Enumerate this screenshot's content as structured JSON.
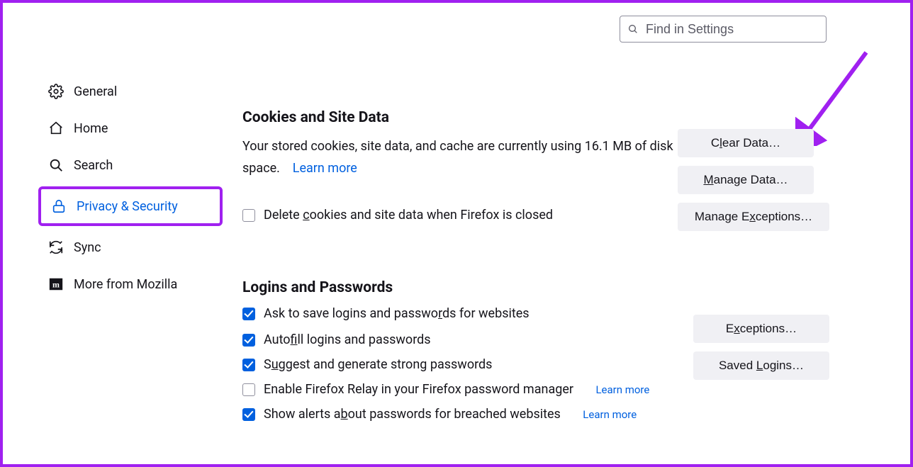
{
  "search": {
    "placeholder": "Find in Settings"
  },
  "sidebar": {
    "items": [
      {
        "label": "General"
      },
      {
        "label": "Home"
      },
      {
        "label": "Search"
      },
      {
        "label": "Privacy & Security"
      },
      {
        "label": "Sync"
      },
      {
        "label": "More from Mozilla"
      }
    ]
  },
  "cookies": {
    "heading": "Cookies and Site Data",
    "desc_prefix": "Your stored cookies, site data, and cache are currently using ",
    "size": "16.1 MB",
    "desc_suffix": " of disk space.",
    "learn_more": "Learn more",
    "delete_on_close": "Delete cookies and site data when Firefox is closed",
    "btn_clear": "Clear Data…",
    "btn_manage": "Manage Data…",
    "btn_exceptions": "Manage Exceptions…"
  },
  "logins": {
    "heading": "Logins and Passwords",
    "ask_save": "Ask to save logins and passwords for websites",
    "autofill": "Autofill logins and passwords",
    "suggest": "Suggest and generate strong passwords",
    "relay": "Enable Firefox Relay in your Firefox password manager",
    "relay_learn": "Learn more",
    "breach": "Show alerts about passwords for breached websites",
    "breach_learn": "Learn more",
    "btn_exceptions": "Exceptions…",
    "btn_saved": "Saved Logins…"
  }
}
